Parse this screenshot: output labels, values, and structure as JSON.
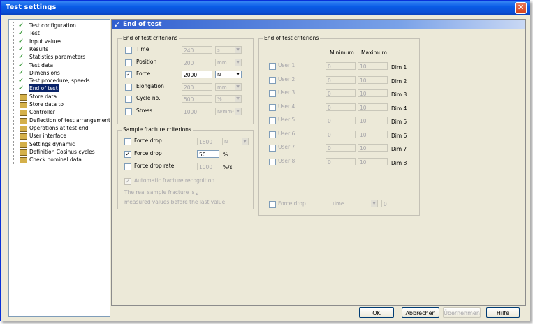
{
  "window": {
    "title": "Test settings",
    "close_glyph": "✕"
  },
  "tree": [
    {
      "label": "Test configuration",
      "icon": "check-icon",
      "selected": false
    },
    {
      "label": "Test",
      "icon": "check-icon",
      "selected": false
    },
    {
      "label": "Input values",
      "icon": "check-icon",
      "selected": false
    },
    {
      "label": "Results",
      "icon": "check-icon",
      "selected": false
    },
    {
      "label": "Statistics parameters",
      "icon": "check-icon",
      "selected": false
    },
    {
      "label": "Test data",
      "icon": "check-icon",
      "selected": false
    },
    {
      "label": "Dimensions",
      "icon": "check-icon",
      "selected": false
    },
    {
      "label": "Test procedure, speeds",
      "icon": "check-icon",
      "selected": false
    },
    {
      "label": "End of test",
      "icon": "check-icon",
      "selected": true
    },
    {
      "label": "Store data",
      "icon": "page-icon",
      "selected": false
    },
    {
      "label": "Store data to",
      "icon": "page-icon",
      "selected": false
    },
    {
      "label": "Controller",
      "icon": "page-icon",
      "selected": false
    },
    {
      "label": "Deflection of test arrangement",
      "icon": "page-icon",
      "selected": false
    },
    {
      "label": "Operations at test end",
      "icon": "page-icon",
      "selected": false
    },
    {
      "label": "User interface",
      "icon": "page-icon",
      "selected": false
    },
    {
      "label": "Settings dynamic",
      "icon": "page-icon",
      "selected": false
    },
    {
      "label": "Definition Cosinus cycles",
      "icon": "page-icon",
      "selected": false
    },
    {
      "label": "Check nominal data",
      "icon": "page-icon",
      "selected": false
    }
  ],
  "panel": {
    "title": "End of test",
    "check_glyph": "✓"
  },
  "left_group": {
    "title": "End of test criterions",
    "rows": [
      {
        "label": "Time",
        "checked": false,
        "value": "240",
        "unit": "s"
      },
      {
        "label": "Position",
        "checked": false,
        "value": "200",
        "unit": "mm"
      },
      {
        "label": "Force",
        "checked": true,
        "value": "2000",
        "unit": "N"
      },
      {
        "label": "Elongation",
        "checked": false,
        "value": "200",
        "unit": "mm"
      },
      {
        "label": "Cycle no.",
        "checked": false,
        "value": "500",
        "unit": "%"
      },
      {
        "label": "Stress",
        "checked": false,
        "value": "1000",
        "unit": "N/mm²"
      }
    ]
  },
  "fracture_group": {
    "title": "Sample fracture criterions",
    "rows": [
      {
        "label": "Force drop",
        "checked": false,
        "value": "1800",
        "unit": "N"
      },
      {
        "label": "Force drop",
        "checked": true,
        "value": "50",
        "unit": "%"
      },
      {
        "label": "Force drop rate",
        "checked": false,
        "value": "1000",
        "unit": "%/s"
      }
    ],
    "auto_label": "Automatic fracture recognition",
    "real_text": "The real sample fracture is",
    "real_value": "2",
    "real_text2": "measured values before the last value."
  },
  "right_group": {
    "title": "End of test criterions",
    "col_min": "Minimum",
    "col_max": "Maximum",
    "rows": [
      {
        "label": "User 1",
        "min": "0",
        "max": "10",
        "dim": "Dim 1"
      },
      {
        "label": "User 2",
        "min": "0",
        "max": "10",
        "dim": "Dim 2"
      },
      {
        "label": "User 3",
        "min": "0",
        "max": "10",
        "dim": "Dim 3"
      },
      {
        "label": "User 4",
        "min": "0",
        "max": "10",
        "dim": "Dim 4"
      },
      {
        "label": "User 5",
        "min": "0",
        "max": "10",
        "dim": "Dim 5"
      },
      {
        "label": "User 6",
        "min": "0",
        "max": "10",
        "dim": "Dim 6"
      },
      {
        "label": "User 7",
        "min": "0",
        "max": "10",
        "dim": "Dim 7"
      },
      {
        "label": "User 8",
        "min": "0",
        "max": "10",
        "dim": "Dim 8"
      }
    ],
    "force_drop_label": "Force drop",
    "force_drop_mode": "Time",
    "force_drop_value": "0"
  },
  "buttons": {
    "ok": "OK",
    "cancel": "Abbrechen",
    "apply": "Übernehmen",
    "help": "Hilfe"
  }
}
